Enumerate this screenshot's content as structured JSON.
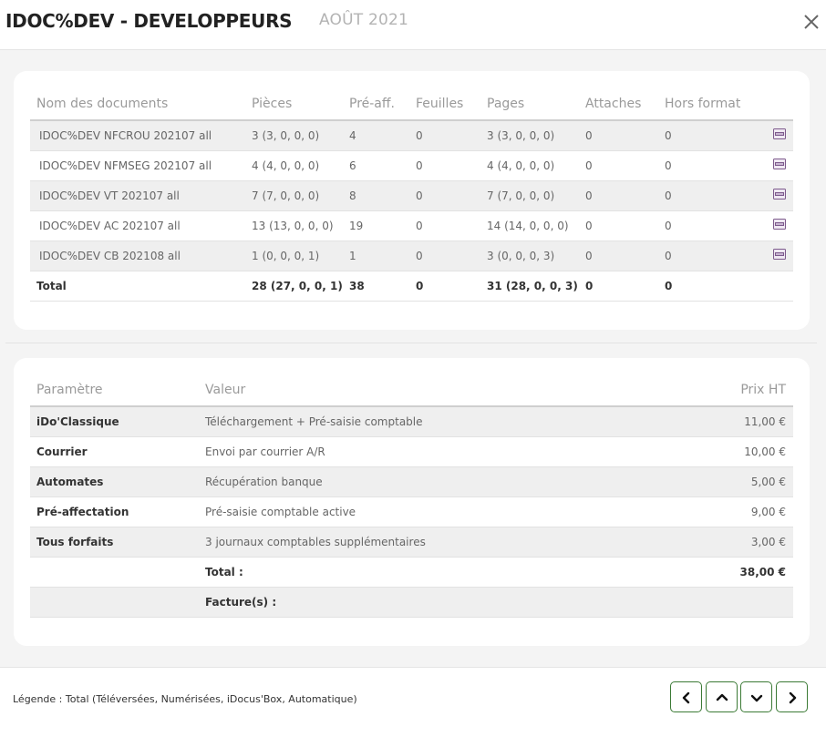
{
  "header": {
    "title": "IDOC%DEV - DEVELOPPEURS",
    "period": "AOÛT 2021"
  },
  "documents": {
    "columns": [
      "Nom des documents",
      "Pièces",
      "Pré-aff.",
      "Feuilles",
      "Pages",
      "Attaches",
      "Hors format"
    ],
    "rows": [
      {
        "name": "IDOC%DEV NFCROU 202107 all",
        "pieces": "3 (3, 0, 0, 0)",
        "preaff": "4",
        "feuilles": "0",
        "pages": "3 (3, 0, 0, 0)",
        "attaches": "0",
        "hors_format": "0",
        "icon": "pdf-file-icon"
      },
      {
        "name": "IDOC%DEV NFMSEG 202107 all",
        "pieces": "4 (4, 0, 0, 0)",
        "preaff": "6",
        "feuilles": "0",
        "pages": "4 (4, 0, 0, 0)",
        "attaches": "0",
        "hors_format": "0",
        "icon": "pdf-file-icon"
      },
      {
        "name": "IDOC%DEV VT 202107 all",
        "pieces": "7 (7, 0, 0, 0)",
        "preaff": "8",
        "feuilles": "0",
        "pages": "7 (7, 0, 0, 0)",
        "attaches": "0",
        "hors_format": "0",
        "icon": "pdf-file-icon"
      },
      {
        "name": "IDOC%DEV AC 202107 all",
        "pieces": "13 (13, 0, 0, 0)",
        "preaff": "19",
        "feuilles": "0",
        "pages": "14 (14, 0, 0, 0)",
        "attaches": "0",
        "hors_format": "0",
        "icon": "pdf-file-icon"
      },
      {
        "name": "IDOC%DEV CB 202108 all",
        "pieces": "1 (0, 0, 0, 1)",
        "preaff": "1",
        "feuilles": "0",
        "pages": "3 (0, 0, 0, 3)",
        "attaches": "0",
        "hors_format": "0",
        "icon": "pdf-file-icon"
      }
    ],
    "total": {
      "label": "Total",
      "pieces": "28 (27, 0, 0, 1)",
      "preaff": "38",
      "feuilles": "0",
      "pages": "31 (28, 0, 0, 3)",
      "attaches": "0",
      "hors_format": "0"
    }
  },
  "pricing": {
    "columns": [
      "Paramètre",
      "Valeur",
      "Prix HT"
    ],
    "rows": [
      {
        "param": "iDo'Classique",
        "value": "Téléchargement + Pré-saisie comptable",
        "price": "11,00 €"
      },
      {
        "param": "Courrier",
        "value": "Envoi par courrier A/R",
        "price": "10,00 €"
      },
      {
        "param": "Automates",
        "value": "Récupération banque",
        "price": "5,00 €"
      },
      {
        "param": "Pré-affectation",
        "value": "Pré-saisie comptable active",
        "price": "9,00 €"
      },
      {
        "param": "Tous forfaits",
        "value": "3 journaux comptables supplémentaires",
        "price": "3,00 €"
      }
    ],
    "total_label": "Total :",
    "total_price": "38,00 €",
    "invoices_label": "Facture(s) :"
  },
  "footer": {
    "legend": "Légende : Total (Téléversées, Numérisées, iDocus'Box, Automatique)"
  },
  "colors": {
    "nav_border": "#3b7a35",
    "icon_purple": "#7d5a8c"
  }
}
